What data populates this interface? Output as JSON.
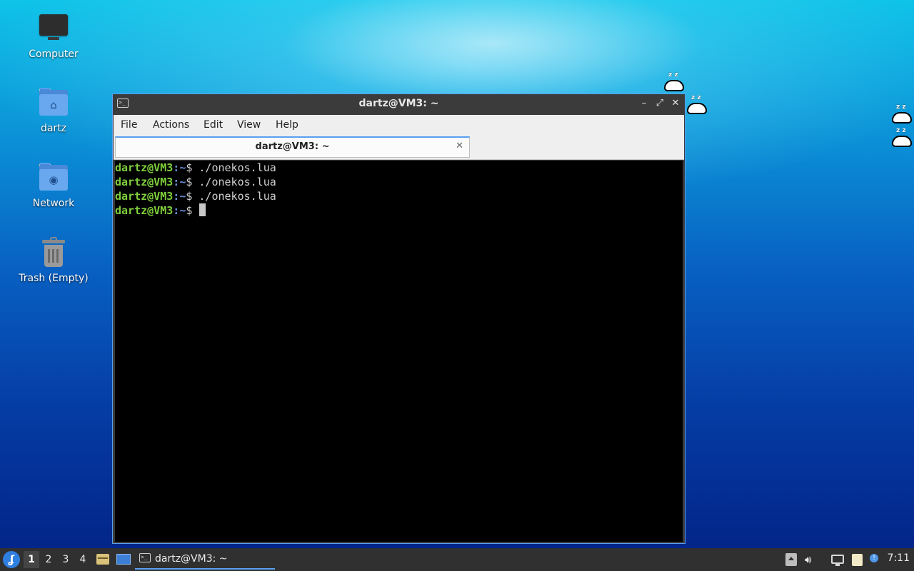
{
  "desktop": {
    "icons": [
      {
        "label": "Computer",
        "icon": "computer-icon"
      },
      {
        "label": "dartz",
        "icon": "home-folder-icon"
      },
      {
        "label": "Network",
        "icon": "network-folder-icon"
      },
      {
        "label": "Trash (Empty)",
        "icon": "trash-icon"
      }
    ]
  },
  "window": {
    "title": "dartz@VM3: ~",
    "controls": {
      "minimize": "–",
      "maximize": "⤢",
      "close": "✕"
    },
    "menu": [
      "File",
      "Actions",
      "Edit",
      "View",
      "Help"
    ],
    "tab": {
      "label": "dartz@VM3: ~",
      "close": "✕"
    }
  },
  "terminal": {
    "lines": [
      {
        "user": "dartz@VM3",
        "sep": ":",
        "path": "~",
        "prompt": "$ ",
        "cmd": "./onekos.lua"
      },
      {
        "user": "dartz@VM3",
        "sep": ":",
        "path": "~",
        "prompt": "$ ",
        "cmd": "./onekos.lua"
      },
      {
        "user": "dartz@VM3",
        "sep": ":",
        "path": "~",
        "prompt": "$ ",
        "cmd": "./onekos.lua"
      },
      {
        "user": "dartz@VM3",
        "sep": ":",
        "path": "~",
        "prompt": "$ ",
        "cmd": ""
      }
    ]
  },
  "taskbar": {
    "workspaces": [
      "1",
      "2",
      "3",
      "4"
    ],
    "active_workspace": "1",
    "task_title": "dartz@VM3: ~",
    "clock": "7:11",
    "accent": "#5aa0f0"
  }
}
